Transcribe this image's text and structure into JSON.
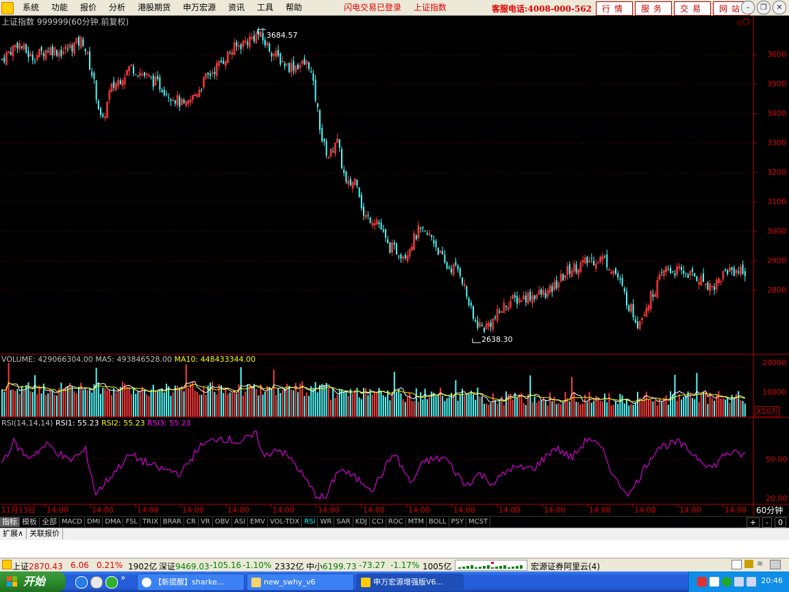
{
  "menu": {
    "items": [
      "系统",
      "功能",
      "报价",
      "分析",
      "港股期货",
      "申万宏源",
      "资讯",
      "工具",
      "帮助"
    ]
  },
  "status_links": [
    "闪电交易已登录",
    "上证指数"
  ],
  "hotline": "客服电话:4008-000-562",
  "top_buttons": [
    "行情",
    "服务",
    "交易",
    "网站"
  ],
  "chart": {
    "title": "上证指数 999999(60分钟.前复权)",
    "max_label": "3684.57",
    "min_label": "2638.30",
    "y_ticks": [
      "3600",
      "3500",
      "3400",
      "3300",
      "3200",
      "3100",
      "3000",
      "2900",
      "2800"
    ],
    "volume_header": {
      "label": "VOLUME: 429066304.00",
      "ma5": "MA5: 493846528.00",
      "ma10": "MA10: 448433344.00"
    },
    "volume_ticks": [
      "20000",
      "10000"
    ],
    "volume_unit": "X10万",
    "rsi_header": {
      "label": "RSI(14,14,14)",
      "rsi1": "RSI1: 55.23",
      "rsi2": "RSI2: 55.23",
      "rsi3": "RSI3: 55.23"
    },
    "rsi_ticks": [
      "50.00",
      "20.00"
    ],
    "x_first": "11月13日",
    "x_ticks": [
      "14:00",
      "14:00",
      "14:00",
      "14:00",
      "14:00",
      "14:00",
      "14:00",
      "14:00",
      "14:00",
      "14:00",
      "14:00",
      "14:00",
      "14:00",
      "14:00",
      "14:00",
      "14:00"
    ],
    "period": "60分钟",
    "colors": {
      "up": "#ff3c3c",
      "down": "#54ffff",
      "ma5": "#ffffff",
      "ma10": "#ffff00",
      "rsi": "#ff00ff",
      "axis": "#c00000"
    }
  },
  "indicator_tabs": [
    "指标",
    "模板",
    "全部",
    "MACD",
    "DMI",
    "DMA",
    "FSL",
    "TRIX",
    "BRAR",
    "CR",
    "VR",
    "OBV",
    "ASI",
    "EMV",
    "VOL-TDX",
    "RSI",
    "WR",
    "SAR",
    "KDJ",
    "CCI",
    "ROC",
    "MTM",
    "BOLL",
    "PSY",
    "MCST"
  ],
  "indicator_right": [
    "+",
    "-",
    "0"
  ],
  "ext_tabs": [
    "扩展∧",
    "关联报价"
  ],
  "status_bar": {
    "sh_label": "上证",
    "sh_value": "2870.43",
    "sh_change": "6.06",
    "sh_pct": "0.21%",
    "sh_amount": "1902亿",
    "sz_label": "深证",
    "sz_value": "9469.03",
    "sz_change": "-105.16",
    "sz_pct": "-1.10%",
    "sz_amount": "2332亿",
    "zx_label": "中小",
    "zx_value": "6199.73",
    "zx_change": "-73.27",
    "zx_pct": "-1.17%",
    "zx_amount": "1005亿",
    "server": "宏源证券阿里云(4)"
  },
  "taskbar": {
    "start": "开始",
    "tasks": [
      "【新提醒】sharke...",
      "new_swhy_v6",
      "申万宏源增强版V6..."
    ],
    "clock": "20:46"
  }
}
